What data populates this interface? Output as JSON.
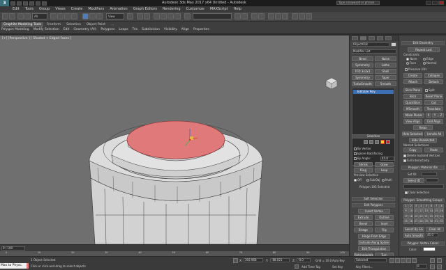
{
  "app": {
    "logo": "3",
    "title": "Autodesk 3ds Max 2017 x64    Untitled - Autodesk",
    "search_placeholder": "Type a keyword or phrase"
  },
  "menu": [
    "Edit",
    "Tools",
    "Group",
    "Views",
    "Create",
    "Modifiers",
    "Animation",
    "Graph Editors",
    "Rendering",
    "Customize",
    "MAXScript",
    "Help"
  ],
  "toolbar": {
    "filter_all": "All",
    "view_label": "View"
  },
  "ribbon": {
    "tabs": [
      "Graphite Modeling Tools",
      "Freeform",
      "Selection",
      "Object Paint",
      "..."
    ],
    "panel": [
      "Polygon Modeling",
      "Modify Selection",
      "Edit",
      "Geometry (All)",
      "Polygons",
      "Loops",
      "Tris",
      "Subdivision",
      "Visibility",
      "Align",
      "Properties"
    ]
  },
  "viewport": {
    "label": "[+] [Perspective ] [ Shaded + Edged Faces ]"
  },
  "modifier_panel": {
    "object_name": "Object018",
    "modifier_list": "Modifier List",
    "buttons": [
      "Bend",
      "Noise",
      "Symmetry",
      "Lathe",
      "FFD 3x3x3",
      "Shell",
      "Symmetry",
      "Taper",
      "TurboSmooth",
      "Smooth"
    ],
    "stack_item": "Editable Poly",
    "selection_title": "Selection",
    "by_vertex": "By Vertex",
    "ignore_backfacing": "Ignore Backfacing",
    "by_angle": "By Angle:",
    "by_angle_value": "45.0",
    "shrink": "Shrink",
    "grow": "Grow",
    "ring": "Ring",
    "loop": "Loop",
    "preview_selection": "Preview Selection",
    "preview_off": "Off",
    "preview_subobj": "SubObj",
    "preview_multi": "Multi",
    "selected_count": "Polygon 195 Selected",
    "soft_selection": "Soft Selection",
    "edit_polygons": "Edit Polygons",
    "insert_vertex": "Insert Vertex",
    "extrude": "Extrude",
    "outline": "Outline",
    "bevel": "Bevel",
    "inset": "Inset",
    "bridge": "Bridge",
    "flip": "Flip",
    "hinge": "Hinge From Edge",
    "extrude_spline": "Extrude Along Spline",
    "edit_triangulation": "Edit Triangulation",
    "retriangulate": "Retriangulate",
    "turn": "Turn"
  },
  "geometry_panel": {
    "title": "Edit Geometry",
    "repeat_last": "Repeat Last",
    "constraints": "Constraints",
    "none": "None",
    "edge": "Edge",
    "face": "Face",
    "normal": "Normal",
    "preserve_uvs": "Preserve UVs",
    "create": "Create",
    "collapse": "Collapse",
    "attach": "Attach",
    "detach": "Detach",
    "slice_plane": "Slice Plane",
    "split": "Split",
    "slice": "Slice",
    "reset_plane": "Reset Plane",
    "quickslice": "QuickSlice",
    "cut": "Cut",
    "msmooth": "MSmooth",
    "tessellate": "Tessellate",
    "make_planar": "Make Planar",
    "xyz": [
      "X",
      "Y",
      "Z"
    ],
    "view_align": "View Align",
    "grid_align": "Grid Align",
    "relax": "Relax",
    "hide_selected": "Hide Selected",
    "unhide_all": "Unhide All",
    "hide_unselected": "Hide Unselected",
    "named_selections": "Named Selections:",
    "copy": "Copy",
    "paste": "Paste",
    "delete_isolated": "Delete Isolated Vertices",
    "full_interactivity": "Full Interactivity",
    "material_ids": "Polygon: Material IDs",
    "set_id": "Set ID:",
    "select_id": "Select ID",
    "clear_selection": "Clear Selection",
    "smoothing_groups": "Polygon: Smoothing Groups",
    "sg_numbers": [
      "1",
      "2",
      "3",
      "4",
      "5",
      "6",
      "7",
      "8",
      "9",
      "10",
      "11",
      "12",
      "13",
      "14",
      "15",
      "16",
      "17",
      "18",
      "19",
      "20",
      "21",
      "22",
      "23",
      "24",
      "25",
      "26",
      "27",
      "28",
      "29",
      "30",
      "31",
      "32"
    ],
    "select_by_sg": "Select By SG",
    "clear_all": "Clear All",
    "auto_smooth": "Auto Smooth",
    "auto_smooth_value": "45.0",
    "vertex_colors": "Polygon: Vertex Colors",
    "color": "Color:"
  },
  "timeline": {
    "frame_label": "0 / 100",
    "ticks": [
      "0",
      "10",
      "20",
      "30",
      "40",
      "50",
      "60",
      "70",
      "80",
      "90",
      "100"
    ]
  },
  "status": {
    "maxscript": "Max to Physc.",
    "line1": "1 Object Selected",
    "line2": "Click or click-and-drag to select objects",
    "x_label": "X:",
    "x": "392.968",
    "y_label": "Y:",
    "y": "-88.021",
    "z_label": "Z:",
    "z": "-0.0",
    "grid": "Grid = 10.0",
    "add_time_tag": "Add Time Tag",
    "auto_key": "Auto Key",
    "selected": "Selected",
    "set_key": "Set Key",
    "key_filters": "Key Filters...",
    "frame": "0"
  },
  "colors": {
    "selection_face": "#e07a7a",
    "viewport_bg": "#6f6f6f",
    "mesh": "#d8d8d8",
    "panel": "#444444",
    "stack_active": "#3d6fb3"
  }
}
